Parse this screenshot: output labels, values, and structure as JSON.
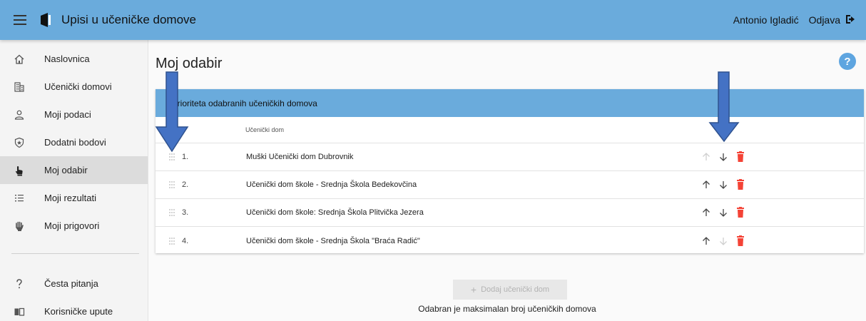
{
  "app": {
    "title": "Upisi u učeničke domove"
  },
  "header": {
    "user_name": "Antonio Igladić",
    "logout_label": "Odjava"
  },
  "sidebar": {
    "items": [
      {
        "label": "Naslovnica",
        "icon": "home-icon"
      },
      {
        "label": "Učenički domovi",
        "icon": "building-icon"
      },
      {
        "label": "Moji podaci",
        "icon": "person-icon"
      },
      {
        "label": "Dodatni bodovi",
        "icon": "shield-star-icon"
      },
      {
        "label": "Moj odabir",
        "icon": "hand-pointer-icon",
        "active": true
      },
      {
        "label": "Moji rezultati",
        "icon": "list-icon"
      },
      {
        "label": "Moji prigovori",
        "icon": "hand-raise-icon"
      }
    ],
    "secondary": [
      {
        "label": "Česta pitanja",
        "icon": "question-icon"
      },
      {
        "label": "Korisničke upute",
        "icon": "book-icon"
      }
    ]
  },
  "main": {
    "title": "Moj odabir",
    "help": "?",
    "card": {
      "header_text": "a prioriteta odabranih učeničkih domova",
      "column_header": "Učenički dom",
      "rows": [
        {
          "rank": "1.",
          "name": "Muški Učenički dom Dubrovnik",
          "up_enabled": false,
          "down_enabled": true
        },
        {
          "rank": "2.",
          "name": "Učenički dom škole - Srednja Škola Bedekovčina",
          "up_enabled": true,
          "down_enabled": true
        },
        {
          "rank": "3.",
          "name": "Učenički dom škole: Srednja Škola Plitvička Jezera",
          "up_enabled": true,
          "down_enabled": true
        },
        {
          "rank": "4.",
          "name": "Učenički dom škole - Srednja Škola \"Braća Radić\"",
          "up_enabled": true,
          "down_enabled": false
        }
      ]
    },
    "add_button": {
      "plus": "+",
      "label": "Dodaj učenički dom"
    },
    "max_text": "Odabran je maksimalan broj učeničkih domova"
  },
  "colors": {
    "topbar": "#6aabdc",
    "accent_blue": "#5ea5e0",
    "delete_red": "#f44336",
    "annotation_arrow": "#4472c4"
  }
}
